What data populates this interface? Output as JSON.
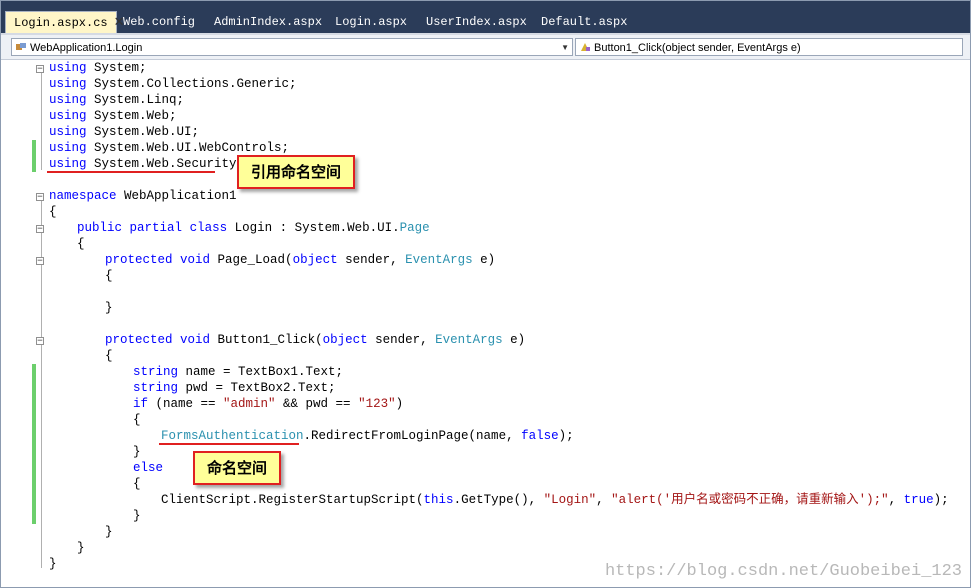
{
  "tabs": [
    {
      "label": "Login.aspx.cs",
      "active": true
    },
    {
      "label": "Web.config"
    },
    {
      "label": "AdminIndex.aspx"
    },
    {
      "label": "Login.aspx"
    },
    {
      "label": "UserIndex.aspx"
    },
    {
      "label": "Default.aspx"
    }
  ],
  "nav": {
    "type_combo": "WebApplication1.Login",
    "member_combo": "Button1_Click(object sender, EventArgs e)"
  },
  "code": {
    "l1": [
      "using",
      " System;"
    ],
    "l2": [
      "using",
      " System.Collections.Generic;"
    ],
    "l3": [
      "using",
      " System.Linq;"
    ],
    "l4": [
      "using",
      " System.Web;"
    ],
    "l5": [
      "using",
      " System.Web.UI;"
    ],
    "l6": [
      "using",
      " System.Web.UI.WebControls;"
    ],
    "l7": [
      "using",
      " System.Web.Security;"
    ],
    "l9": [
      "namespace",
      " WebApplication1"
    ],
    "l10": "{",
    "l11": [
      "public",
      " ",
      "partial",
      " ",
      "class",
      " Login : System.Web.UI.",
      "Page"
    ],
    "l12": "{",
    "l13": [
      "protected",
      " ",
      "void",
      " Page_Load(",
      "object",
      " sender, ",
      "EventArgs",
      " e)"
    ],
    "l14": "{",
    "l16": "}",
    "l18": [
      "protected",
      " ",
      "void",
      " Button1_Click(",
      "object",
      " sender, ",
      "EventArgs",
      " e)"
    ],
    "l19": "{",
    "l20": [
      "string",
      " name = TextBox1.Text;"
    ],
    "l21": [
      "string",
      " pwd = TextBox2.Text;"
    ],
    "l22": [
      "if",
      " (name == ",
      "\"admin\"",
      " && pwd == ",
      "\"123\"",
      ")"
    ],
    "l23": "{",
    "l24": [
      "FormsAuthentication",
      ".RedirectFromLoginPage(name, ",
      "false",
      ");"
    ],
    "l25": "}",
    "l26": "else",
    "l27": "{",
    "l28": [
      "ClientScript.RegisterStartupScript(",
      "this",
      ".GetType(), ",
      "\"Login\"",
      ", ",
      "\"alert('用户名或密码不正确，请重新输入');\"",
      ", ",
      "true",
      ");"
    ],
    "l29": "}",
    "l30": "}",
    "l31": "}",
    "l32": "}"
  },
  "callouts": {
    "ref_namespace": "引用命名空间",
    "namespace": "命名空间"
  },
  "watermark": "https://blog.csdn.net/Guobeibei_123"
}
